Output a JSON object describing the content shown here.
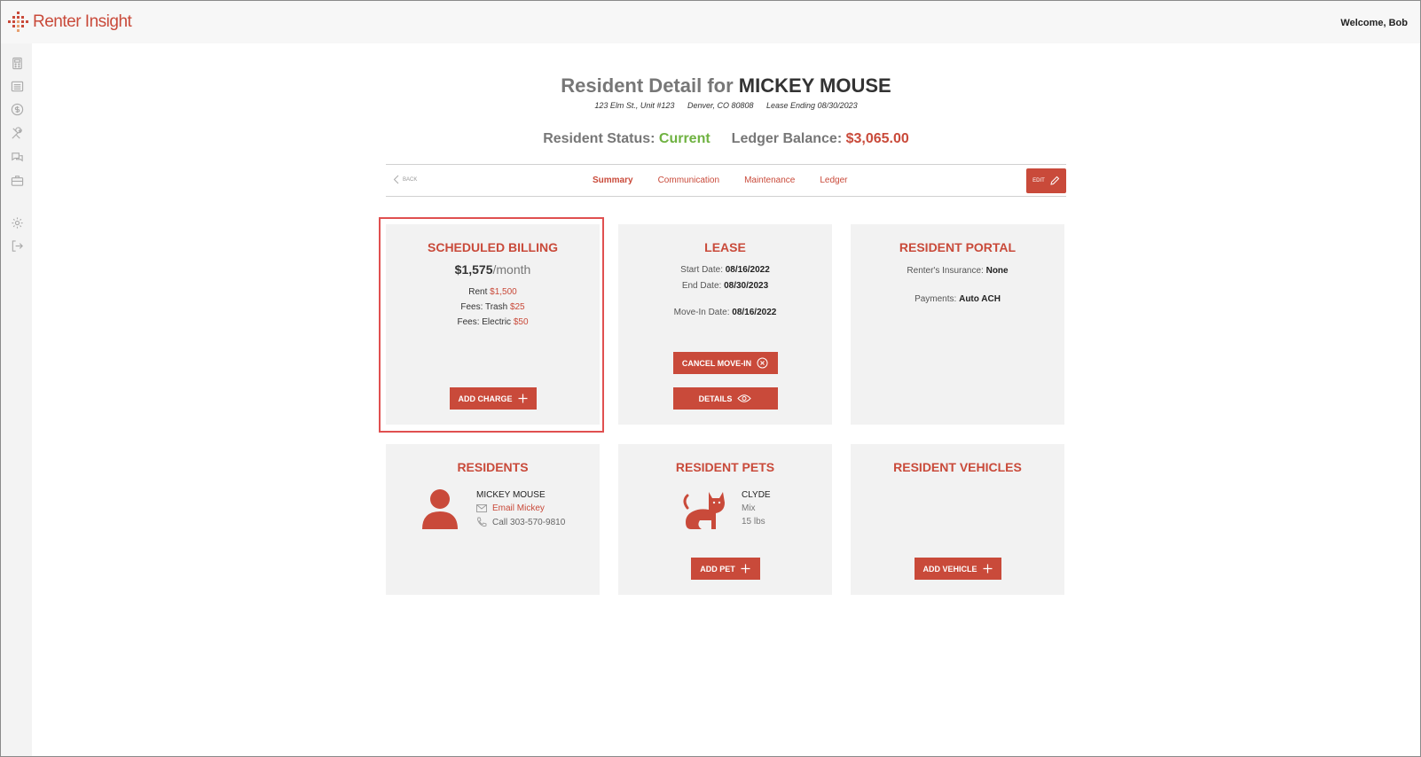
{
  "app": {
    "brand": "Renter Insight",
    "welcome": "Welcome, Bob"
  },
  "header": {
    "title_prefix": "Resident Detail for ",
    "resident_name": "MICKEY MOUSE",
    "address": "123 Elm St., Unit #123",
    "city": "Denver, CO 80808",
    "lease_ending": "Lease Ending 08/30/2023",
    "status_label": "Resident Status: ",
    "status_value": "Current",
    "balance_label": "Ledger Balance: ",
    "balance_value": "$3,065.00"
  },
  "nav": {
    "back": "BACK",
    "tabs": [
      "Summary",
      "Communication",
      "Maintenance",
      "Ledger"
    ],
    "edit": "EDIT"
  },
  "billing": {
    "title": "SCHEDULED BILLING",
    "amount": "$1,575",
    "period": "/month",
    "rent_label": "Rent ",
    "rent_value": "$1,500",
    "trash_label": "Fees: Trash ",
    "trash_value": "$25",
    "electric_label": "Fees: Electric ",
    "electric_value": "$50",
    "add_button": "ADD CHARGE"
  },
  "lease": {
    "title": "LEASE",
    "start_label": "Start Date: ",
    "start_value": "08/16/2022",
    "end_label": "End Date: ",
    "end_value": "08/30/2023",
    "movein_label": "Move-In Date: ",
    "movein_value": "08/16/2022",
    "cancel_button": "CANCEL MOVE-IN",
    "details_button": "DETAILS"
  },
  "portal": {
    "title": "RESIDENT PORTAL",
    "insurance_label": "Renter's Insurance: ",
    "insurance_value": "None",
    "payments_label": "Payments: ",
    "payments_value": "Auto ACH"
  },
  "residents": {
    "title": "RESIDENTS",
    "name": "MICKEY MOUSE",
    "email": "Email Mickey",
    "phone": "Call 303-570-9810"
  },
  "pets": {
    "title": "RESIDENT PETS",
    "name": "CLYDE",
    "breed": "Mix",
    "weight": "15 lbs",
    "add_button": "ADD PET"
  },
  "vehicles": {
    "title": "RESIDENT VEHICLES",
    "add_button": "ADD VEHICLE"
  },
  "colors": {
    "accent": "#c94a3a",
    "status_green": "#6fb241",
    "card_bg": "#f2f2f2"
  }
}
